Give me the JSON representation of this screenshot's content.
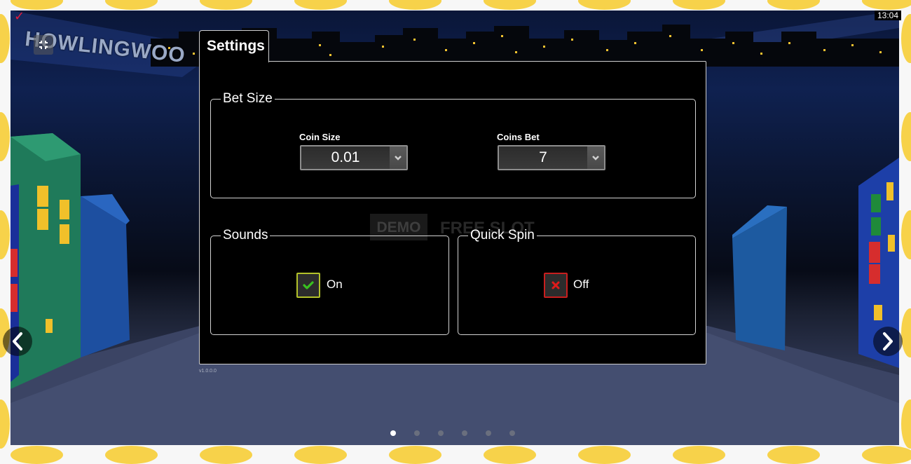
{
  "clock": "13:04",
  "logo": {
    "text": "HOWLINGWOO"
  },
  "settings": {
    "title": "Settings",
    "bet_size": {
      "legend": "Bet Size",
      "coin_size": {
        "label": "Coin Size",
        "value": "0.01"
      },
      "coins_bet": {
        "label": "Coins Bet",
        "value": "7"
      }
    },
    "sounds": {
      "legend": "Sounds",
      "state_label": "On",
      "checked": true
    },
    "quick_spin": {
      "legend": "Quick Spin",
      "state_label": "Off",
      "checked": false
    }
  },
  "watermark": {
    "demo": "DEMO",
    "free_slot": "FREE SLOT"
  },
  "version": "v1.0.0.0",
  "pagination": {
    "pages": 6,
    "current": 1
  },
  "icons": {
    "fullscreen": "collapse-fullscreen-icon",
    "prev": "chevron-left-icon",
    "next": "chevron-right-icon",
    "dropdown": "chevron-down-icon",
    "on": "check-icon",
    "off": "close-icon",
    "brand": "checkmark-brand-icon"
  },
  "colors": {
    "frame_yellow": "#f7d24a",
    "panel_bg": "#000000",
    "toggle_on_border": "#b3c22a",
    "toggle_on_check": "#39c11f",
    "toggle_off_border": "#c81e1e",
    "toggle_off_x": "#e01a1a"
  }
}
